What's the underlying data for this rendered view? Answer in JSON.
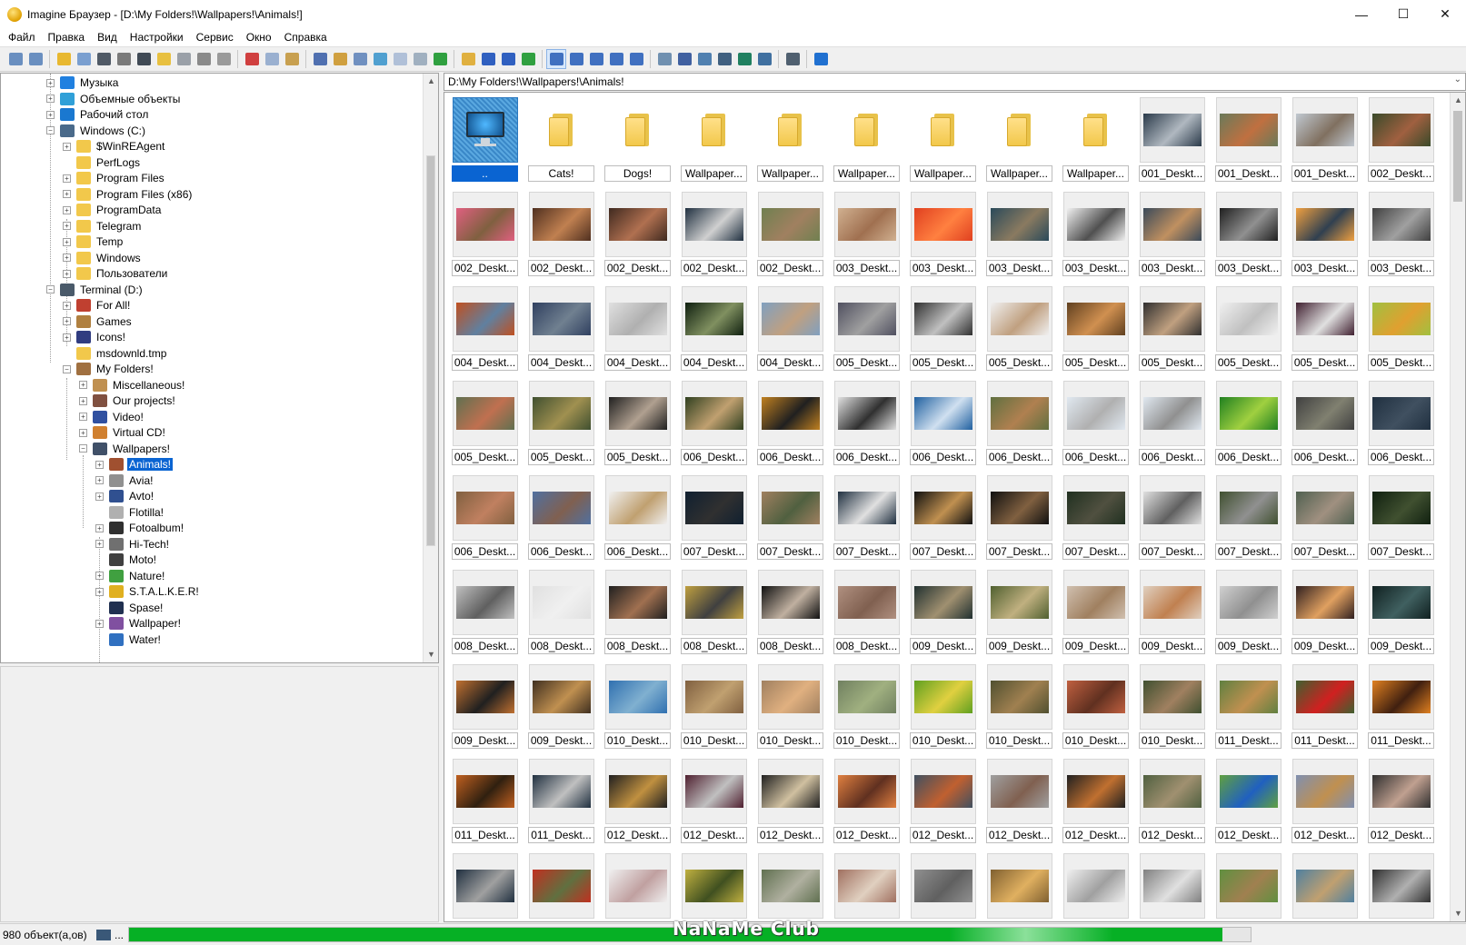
{
  "window": {
    "title": "Imagine Браузер - [D:\\My Folders!\\Wallpapers!\\Animals!]",
    "controls": {
      "minimize": "—",
      "maximize": "☐",
      "close": "✕"
    }
  },
  "menu": [
    "Файл",
    "Правка",
    "Вид",
    "Настройки",
    "Сервис",
    "Окно",
    "Справка"
  ],
  "toolbar": {
    "icons": [
      "view-icon",
      "slideshow-icon",
      "open-icon",
      "copy-to-icon",
      "print-icon",
      "info-icon",
      "scan-icon",
      "new-folder-icon",
      "rename-icon",
      "delete-icon",
      "properties-icon",
      "cut-icon",
      "copy-icon",
      "paste-icon",
      "fullscreen-icon",
      "tree-icon",
      "preview-icon",
      "thumbnails-icon",
      "toolbar-icon",
      "status-icon",
      "fit-icon",
      "up-folder-icon",
      "back-icon",
      "forward-icon",
      "refresh-icon",
      "large-thumbs-icon",
      "small-thumbs-icon",
      "list-icon",
      "details-icon",
      "report-icon",
      "tools-icon",
      "find-icon",
      "compare-icon",
      "batch-icon",
      "convert-icon",
      "wallpaper-icon",
      "edit-icon",
      "help-icon"
    ],
    "colors": [
      "#6a8fc0",
      "#6a8fc0",
      "#e8b830",
      "#7a9fd0",
      "#505a66",
      "#7a7a7a",
      "#404a55",
      "#e8c040",
      "#9aa0a8",
      "#8a8a8a",
      "#9a9a9a",
      "#d04040",
      "#9ab0d0",
      "#c8a050",
      "#5070b0",
      "#d0a040",
      "#7090c0",
      "#50a0d0",
      "#b0c0d8",
      "#a0b0c0",
      "#30a040",
      "#e0b040",
      "#3060c0",
      "#3060c0",
      "#30a040",
      "#4070c0",
      "#4070c0",
      "#4070c0",
      "#4070c0",
      "#4070c0",
      "#7090b0",
      "#4060a0",
      "#5080b0",
      "#406080",
      "#208060",
      "#4070a0",
      "#506070",
      "#2070d0"
    ]
  },
  "tree": {
    "nodes": [
      {
        "label": "Музыка",
        "color": "#2080e0",
        "exp": "+"
      },
      {
        "label": "Объемные объекты",
        "color": "#30a0d8",
        "exp": "+"
      },
      {
        "label": "Рабочий стол",
        "color": "#1a78d0",
        "exp": "+"
      },
      {
        "label": "Windows (C:)",
        "color": "#4a6a8a",
        "exp": "−"
      },
      {
        "label": "$WinREAgent",
        "color": "#f2c84b",
        "exp": "+"
      },
      {
        "label": "PerfLogs",
        "color": "#f2c84b",
        "exp": ""
      },
      {
        "label": "Program Files",
        "color": "#f2c84b",
        "exp": "+"
      },
      {
        "label": "Program Files (x86)",
        "color": "#f2c84b",
        "exp": "+"
      },
      {
        "label": "ProgramData",
        "color": "#f2c84b",
        "exp": "+"
      },
      {
        "label": "Telegram",
        "color": "#f2c84b",
        "exp": "+"
      },
      {
        "label": "Temp",
        "color": "#f2c84b",
        "exp": "+"
      },
      {
        "label": "Windows",
        "color": "#f2c84b",
        "exp": "+"
      },
      {
        "label": "Пользователи",
        "color": "#f2c84b",
        "exp": "+"
      },
      {
        "label": "Terminal (D:)",
        "color": "#4a5a6a",
        "exp": "−"
      },
      {
        "label": "For All!",
        "color": "#c04030",
        "exp": "+"
      },
      {
        "label": "Games",
        "color": "#b08040",
        "exp": "+"
      },
      {
        "label": "Icons!",
        "color": "#303c80",
        "exp": "+"
      },
      {
        "label": "msdownld.tmp",
        "color": "#f2c84b",
        "exp": ""
      },
      {
        "label": "My Folders!",
        "color": "#a07040",
        "exp": "−"
      },
      {
        "label": "Miscellaneous!",
        "color": "#c09050",
        "exp": "+"
      },
      {
        "label": "Our projects!",
        "color": "#805040",
        "exp": "+"
      },
      {
        "label": "Video!",
        "color": "#3050a0",
        "exp": "+"
      },
      {
        "label": "Virtual CD!",
        "color": "#d08030",
        "exp": "+"
      },
      {
        "label": "Wallpapers!",
        "color": "#405068",
        "exp": "−"
      },
      {
        "label": "Animals!",
        "color": "#a05030",
        "exp": "+",
        "selected": true
      },
      {
        "label": "Avia!",
        "color": "#909090",
        "exp": "+"
      },
      {
        "label": "Avto!",
        "color": "#305090",
        "exp": "+"
      },
      {
        "label": "Flotilla!",
        "color": "#b0b0b0",
        "exp": ""
      },
      {
        "label": "Fotoalbum!",
        "color": "#303030",
        "exp": "+"
      },
      {
        "label": "Hi-Tech!",
        "color": "#707070",
        "exp": "+"
      },
      {
        "label": "Moto!",
        "color": "#404040",
        "exp": ""
      },
      {
        "label": "Nature!",
        "color": "#40a040",
        "exp": "+"
      },
      {
        "label": "S.T.A.L.K.E.R!",
        "color": "#e0b020",
        "exp": "+"
      },
      {
        "label": "Spase!",
        "color": "#203050",
        "exp": ""
      },
      {
        "label": "Wallpaper!",
        "color": "#8050a0",
        "exp": "+"
      },
      {
        "label": "Water!",
        "color": "#3070c0",
        "exp": ""
      }
    ],
    "indents": [
      50,
      50,
      50,
      50,
      68,
      68,
      68,
      68,
      68,
      68,
      68,
      68,
      68,
      50,
      68,
      68,
      68,
      68,
      68,
      86,
      86,
      86,
      86,
      86,
      104,
      104,
      104,
      104,
      104,
      104,
      104,
      104,
      104,
      104,
      104,
      104
    ]
  },
  "path": "D:\\My Folders!\\Wallpapers!\\Animals!",
  "grid": {
    "items": [
      {
        "label": "..",
        "kind": "up",
        "selected": true
      },
      {
        "label": "Cats!",
        "kind": "folder"
      },
      {
        "label": "Dogs!",
        "kind": "folder"
      },
      {
        "label": "Wallpaper...",
        "kind": "folder"
      },
      {
        "label": "Wallpaper...",
        "kind": "folder"
      },
      {
        "label": "Wallpaper...",
        "kind": "folder"
      },
      {
        "label": "Wallpaper...",
        "kind": "folder"
      },
      {
        "label": "Wallpaper...",
        "kind": "folder"
      },
      {
        "label": "Wallpaper...",
        "kind": "folder"
      },
      {
        "label": "001_Deskt...",
        "kind": "photo",
        "c1": "#2a3a4a",
        "c2": "#b0b8c0"
      },
      {
        "label": "001_Deskt...",
        "kind": "photo",
        "c1": "#6a7a5a",
        "c2": "#c07040"
      },
      {
        "label": "001_Deskt...",
        "kind": "photo",
        "c1": "#c0c8d0",
        "c2": "#807060"
      },
      {
        "label": "002_Deskt...",
        "kind": "photo",
        "c1": "#3a4a2a",
        "c2": "#a06040"
      },
      {
        "label": "002_Deskt...",
        "kind": "photo",
        "c1": "#e06080",
        "c2": "#806040"
      },
      {
        "label": "002_Deskt...",
        "kind": "photo",
        "c1": "#503020",
        "c2": "#c08050"
      },
      {
        "label": "002_Deskt...",
        "kind": "photo",
        "c1": "#402a20",
        "c2": "#b07050"
      },
      {
        "label": "002_Deskt...",
        "kind": "photo",
        "c1": "#203040",
        "c2": "#d0d0d0"
      },
      {
        "label": "002_Deskt...",
        "kind": "photo",
        "c1": "#708050",
        "c2": "#a08060"
      },
      {
        "label": "003_Deskt...",
        "kind": "photo",
        "c1": "#d0b090",
        "c2": "#a07050"
      },
      {
        "label": "003_Deskt...",
        "kind": "photo",
        "c1": "#e04020",
        "c2": "#ff8040"
      },
      {
        "label": "003_Deskt...",
        "kind": "photo",
        "c1": "#2a4a5a",
        "c2": "#8a7a60"
      },
      {
        "label": "003_Deskt...",
        "kind": "photo",
        "c1": "#f0f0f0",
        "c2": "#505050"
      },
      {
        "label": "003_Deskt...",
        "kind": "photo",
        "c1": "#3a4a5a",
        "c2": "#c09060"
      },
      {
        "label": "003_Deskt...",
        "kind": "photo",
        "c1": "#202020",
        "c2": "#909090"
      },
      {
        "label": "003_Deskt...",
        "kind": "photo",
        "c1": "#f0a040",
        "c2": "#304050"
      },
      {
        "label": "003_Deskt...",
        "kind": "photo",
        "c1": "#404040",
        "c2": "#a0a0a0"
      },
      {
        "label": "004_Deskt...",
        "kind": "photo",
        "c1": "#c05020",
        "c2": "#6080a0"
      },
      {
        "label": "004_Deskt...",
        "kind": "photo",
        "c1": "#304060",
        "c2": "#708090"
      },
      {
        "label": "004_Deskt...",
        "kind": "photo",
        "c1": "#e0e0e0",
        "c2": "#b0b0b0"
      },
      {
        "label": "004_Deskt...",
        "kind": "photo",
        "c1": "#102010",
        "c2": "#809060"
      },
      {
        "label": "004_Deskt...",
        "kind": "photo",
        "c1": "#80a0c0",
        "c2": "#c0a080"
      },
      {
        "label": "005_Deskt...",
        "kind": "photo",
        "c1": "#505060",
        "c2": "#a0a0a0"
      },
      {
        "label": "005_Deskt...",
        "kind": "photo",
        "c1": "#303030",
        "c2": "#c0c0c0"
      },
      {
        "label": "005_Deskt...",
        "kind": "photo",
        "c1": "#f0f0f0",
        "c2": "#c0a080"
      },
      {
        "label": "005_Deskt...",
        "kind": "photo",
        "c1": "#604020",
        "c2": "#d09050"
      },
      {
        "label": "005_Deskt...",
        "kind": "photo",
        "c1": "#303030",
        "c2": "#c0a080"
      },
      {
        "label": "005_Deskt...",
        "kind": "photo",
        "c1": "#f0f0f0",
        "c2": "#c0c0c0"
      },
      {
        "label": "005_Deskt...",
        "kind": "photo",
        "c1": "#402030",
        "c2": "#e0e0e0"
      },
      {
        "label": "005_Deskt...",
        "kind": "photo",
        "c1": "#a0c040",
        "c2": "#e0a030"
      },
      {
        "label": "005_Deskt...",
        "kind": "photo",
        "c1": "#607050",
        "c2": "#c07050"
      },
      {
        "label": "005_Deskt...",
        "kind": "photo",
        "c1": "#405030",
        "c2": "#a09050"
      },
      {
        "label": "005_Deskt...",
        "kind": "photo",
        "c1": "#202020",
        "c2": "#b0a090"
      },
      {
        "label": "006_Deskt...",
        "kind": "photo",
        "c1": "#304020",
        "c2": "#c0a070"
      },
      {
        "label": "006_Deskt...",
        "kind": "photo",
        "c1": "#c08020",
        "c2": "#202020"
      },
      {
        "label": "006_Deskt...",
        "kind": "photo",
        "c1": "#e0e0e0",
        "c2": "#303030"
      },
      {
        "label": "006_Deskt...",
        "kind": "photo",
        "c1": "#2060a0",
        "c2": "#d0e0f0"
      },
      {
        "label": "006_Deskt...",
        "kind": "photo",
        "c1": "#607040",
        "c2": "#b08050"
      },
      {
        "label": "006_Deskt...",
        "kind": "photo",
        "c1": "#e0e8f0",
        "c2": "#b0b0b0"
      },
      {
        "label": "006_Deskt...",
        "kind": "photo",
        "c1": "#e0e8f0",
        "c2": "#909090"
      },
      {
        "label": "006_Deskt...",
        "kind": "photo",
        "c1": "#208020",
        "c2": "#a0d040"
      },
      {
        "label": "006_Deskt...",
        "kind": "photo",
        "c1": "#404040",
        "c2": "#808070"
      },
      {
        "label": "006_Deskt...",
        "kind": "photo",
        "c1": "#203040",
        "c2": "#405060"
      },
      {
        "label": "006_Deskt...",
        "kind": "photo",
        "c1": "#806040",
        "c2": "#c08060"
      },
      {
        "label": "006_Deskt...",
        "kind": "photo",
        "c1": "#5070a0",
        "c2": "#806050"
      },
      {
        "label": "006_Deskt...",
        "kind": "photo",
        "c1": "#f0f0f0",
        "c2": "#c0a070"
      },
      {
        "label": "007_Deskt...",
        "kind": "photo",
        "c1": "#102030",
        "c2": "#303030"
      },
      {
        "label": "007_Deskt...",
        "kind": "photo",
        "c1": "#a08060",
        "c2": "#506040"
      },
      {
        "label": "007_Deskt...",
        "kind": "photo",
        "c1": "#203040",
        "c2": "#e0e0e0"
      },
      {
        "label": "007_Deskt...",
        "kind": "photo",
        "c1": "#101010",
        "c2": "#c09050"
      },
      {
        "label": "007_Deskt...",
        "kind": "photo",
        "c1": "#101010",
        "c2": "#806040"
      },
      {
        "label": "007_Deskt...",
        "kind": "photo",
        "c1": "#203020",
        "c2": "#505040"
      },
      {
        "label": "007_Deskt...",
        "kind": "photo",
        "c1": "#e0e0e0",
        "c2": "#606060"
      },
      {
        "label": "007_Deskt...",
        "kind": "photo",
        "c1": "#405030",
        "c2": "#909090"
      },
      {
        "label": "007_Deskt...",
        "kind": "photo",
        "c1": "#506050",
        "c2": "#a09080"
      },
      {
        "label": "007_Deskt...",
        "kind": "photo",
        "c1": "#102010",
        "c2": "#405030"
      },
      {
        "label": "008_Deskt...",
        "kind": "photo",
        "c1": "#c0c0c0",
        "c2": "#606060"
      },
      {
        "label": "008_Deskt...",
        "kind": "photo",
        "c1": "#e0e0e0",
        "c2": "#f0f0f0"
      },
      {
        "label": "008_Deskt...",
        "kind": "photo",
        "c1": "#202020",
        "c2": "#a07050"
      },
      {
        "label": "008_Deskt...",
        "kind": "photo",
        "c1": "#c0a040",
        "c2": "#404040"
      },
      {
        "label": "008_Deskt...",
        "kind": "photo",
        "c1": "#101010",
        "c2": "#c0b0a0"
      },
      {
        "label": "008_Deskt...",
        "kind": "photo",
        "c1": "#b09080",
        "c2": "#806050"
      },
      {
        "label": "009_Deskt...",
        "kind": "photo",
        "c1": "#203030",
        "c2": "#a09070"
      },
      {
        "label": "009_Deskt...",
        "kind": "photo",
        "c1": "#506030",
        "c2": "#c0b080"
      },
      {
        "label": "009_Deskt...",
        "kind": "photo",
        "c1": "#d0c0b0",
        "c2": "#a08060"
      },
      {
        "label": "009_Deskt...",
        "kind": "photo",
        "c1": "#e0d0c0",
        "c2": "#c08050"
      },
      {
        "label": "009_Deskt...",
        "kind": "photo",
        "c1": "#d0d0d0",
        "c2": "#909090"
      },
      {
        "label": "009_Deskt...",
        "kind": "photo",
        "c1": "#302020",
        "c2": "#e0a060"
      },
      {
        "label": "009_Deskt...",
        "kind": "photo",
        "c1": "#102020",
        "c2": "#406060"
      },
      {
        "label": "009_Deskt...",
        "kind": "photo",
        "c1": "#c07030",
        "c2": "#202020"
      },
      {
        "label": "009_Deskt...",
        "kind": "photo",
        "c1": "#403020",
        "c2": "#c09050"
      },
      {
        "label": "010_Deskt...",
        "kind": "photo",
        "c1": "#3070b0",
        "c2": "#80b0d0"
      },
      {
        "label": "010_Deskt...",
        "kind": "photo",
        "c1": "#806040",
        "c2": "#c0a070"
      },
      {
        "label": "010_Deskt...",
        "kind": "photo",
        "c1": "#a08060",
        "c2": "#e0b080"
      },
      {
        "label": "010_Deskt...",
        "kind": "photo",
        "c1": "#708060",
        "c2": "#a0b080"
      },
      {
        "label": "010_Deskt...",
        "kind": "photo",
        "c1": "#60a020",
        "c2": "#e0d040"
      },
      {
        "label": "010_Deskt...",
        "kind": "photo",
        "c1": "#505030",
        "c2": "#a08050"
      },
      {
        "label": "010_Deskt...",
        "kind": "photo",
        "c1": "#c06040",
        "c2": "#603020"
      },
      {
        "label": "010_Deskt...",
        "kind": "photo",
        "c1": "#405030",
        "c2": "#a08060"
      },
      {
        "label": "011_Deskt...",
        "kind": "photo",
        "c1": "#608040",
        "c2": "#c09050"
      },
      {
        "label": "011_Deskt...",
        "kind": "photo",
        "c1": "#406030",
        "c2": "#d02020"
      },
      {
        "label": "011_Deskt...",
        "kind": "photo",
        "c1": "#e08020",
        "c2": "#402010"
      },
      {
        "label": "011_Deskt...",
        "kind": "photo",
        "c1": "#c06020",
        "c2": "#302010"
      },
      {
        "label": "011_Deskt...",
        "kind": "photo",
        "c1": "#203040",
        "c2": "#c0c0c0"
      },
      {
        "label": "012_Deskt...",
        "kind": "photo",
        "c1": "#202020",
        "c2": "#c09040"
      },
      {
        "label": "012_Deskt...",
        "kind": "photo",
        "c1": "#502030",
        "c2": "#c0c0c0"
      },
      {
        "label": "012_Deskt...",
        "kind": "photo",
        "c1": "#202020",
        "c2": "#d0c0a0"
      },
      {
        "label": "012_Deskt...",
        "kind": "photo",
        "c1": "#e08040",
        "c2": "#603020"
      },
      {
        "label": "012_Deskt...",
        "kind": "photo",
        "c1": "#405060",
        "c2": "#c06030"
      },
      {
        "label": "012_Deskt...",
        "kind": "photo",
        "c1": "#a0a0a0",
        "c2": "#806050"
      },
      {
        "label": "012_Deskt...",
        "kind": "photo",
        "c1": "#202020",
        "c2": "#c07030"
      },
      {
        "label": "012_Deskt...",
        "kind": "photo",
        "c1": "#506040",
        "c2": "#a09070"
      },
      {
        "label": "012_Deskt...",
        "kind": "photo",
        "c1": "#60a040",
        "c2": "#2060c0"
      },
      {
        "label": "012_Deskt...",
        "kind": "photo",
        "c1": "#8090b0",
        "c2": "#c09050"
      },
      {
        "label": "012_Deskt...",
        "kind": "photo",
        "c1": "#303030",
        "c2": "#c0a090"
      },
      {
        "label": "",
        "kind": "photo",
        "c1": "#203040",
        "c2": "#a0a0a0"
      },
      {
        "label": "",
        "kind": "photo",
        "c1": "#c03020",
        "c2": "#607040"
      },
      {
        "label": "",
        "kind": "photo",
        "c1": "#f0f0f0",
        "c2": "#c0a0a0"
      },
      {
        "label": "",
        "kind": "photo",
        "c1": "#c0b040",
        "c2": "#405020"
      },
      {
        "label": "",
        "kind": "photo",
        "c1": "#607050",
        "c2": "#b0b0a0"
      },
      {
        "label": "",
        "kind": "photo",
        "c1": "#a07060",
        "c2": "#e0d0c0"
      },
      {
        "label": "",
        "kind": "photo",
        "c1": "#909090",
        "c2": "#606060"
      },
      {
        "label": "",
        "kind": "photo",
        "c1": "#806030",
        "c2": "#e0b060"
      },
      {
        "label": "",
        "kind": "photo",
        "c1": "#f0f0f0",
        "c2": "#a0a0a0"
      },
      {
        "label": "",
        "kind": "photo",
        "c1": "#808080",
        "c2": "#e0e0e0"
      },
      {
        "label": "",
        "kind": "photo",
        "c1": "#609040",
        "c2": "#a08050"
      },
      {
        "label": "",
        "kind": "photo",
        "c1": "#5080a0",
        "c2": "#c0a070"
      },
      {
        "label": "",
        "kind": "photo",
        "c1": "#303030",
        "c2": "#b0b0b0"
      }
    ]
  },
  "status": {
    "count": "980 объект(а,ов)",
    "dots": "...",
    "progress_fraction": 0.975,
    "watermark": "NaNaMe Club"
  }
}
